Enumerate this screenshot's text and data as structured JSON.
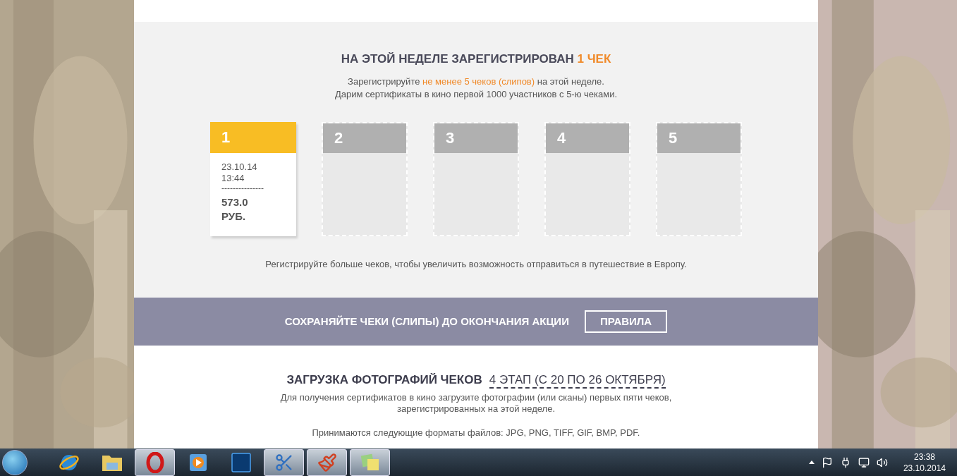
{
  "weekly": {
    "title": "НА ЭТОЙ НЕДЕЛЕ ЗАРЕГИСТРИРОВАН ",
    "title_highlight": "1 ЧЕК",
    "intro_before": "Зарегистрируйте ",
    "intro_highlight": "не менее 5 чеков (слипов)",
    "intro_after": " на этой неделе.",
    "intro_line2": "Дарим сертификаты в кино первой 1000 участников с 5-ю чеками.",
    "receipts": [
      {
        "number": "1",
        "filled": true,
        "date": "23.10.14",
        "time": "13:44",
        "separator": "---------------",
        "amount": "573.0",
        "currency": "РУБ."
      },
      {
        "number": "2",
        "filled": false
      },
      {
        "number": "3",
        "filled": false
      },
      {
        "number": "4",
        "filled": false
      },
      {
        "number": "5",
        "filled": false
      }
    ],
    "footnote": "Регистрируйте больше чеков, чтобы увеличить возможность отправиться в путешествие в Европу."
  },
  "banner": {
    "text": "СОХРАНЯЙТЕ ЧЕКИ (СЛИПЫ) ДО ОКОНЧАНИЯ АКЦИИ",
    "button": "ПРАВИЛА"
  },
  "upload": {
    "title": "ЗАГРУЗКА ФОТОГРАФИЙ ЧЕКОВ",
    "stage": "4 ЭТАП (С 20 ПО 26 ОКТЯБРЯ)",
    "description": "Для получения сертификатов в кино загрузите фотографии (или сканы) первых пяти чеков, зарегистрированных на этой неделе.",
    "formats": "Принимаются следующие форматы файлов: JPG, PNG, TIFF, GIF, BMP, PDF."
  },
  "taskbar": {
    "apps": [
      {
        "kind": "globe",
        "open": false
      },
      {
        "kind": "folder",
        "open": false
      },
      {
        "kind": "ring",
        "open": true
      },
      {
        "kind": "play",
        "open": false
      },
      {
        "kind": "square",
        "open": false
      },
      {
        "kind": "scissors",
        "open": true
      },
      {
        "kind": "brush",
        "open": true
      },
      {
        "kind": "notes",
        "open": true
      }
    ],
    "time": "23:38",
    "date": "23.10.2014"
  }
}
